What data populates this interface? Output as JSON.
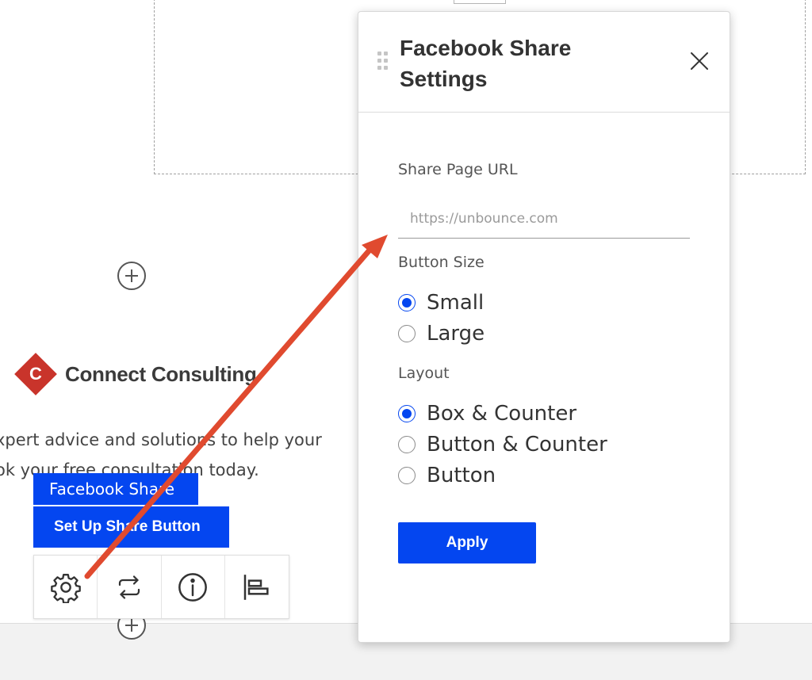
{
  "canvas": {
    "logo_letter": "C",
    "brand_name": "Connect Consulting",
    "body_line_1": "xpert advice and solutions to help your",
    "body_line_2": "ok your free consultation today."
  },
  "widget": {
    "tag_label": "Facebook Share",
    "setup_label": "Set Up Share Button",
    "toolbar": [
      {
        "name": "settings-gear-icon"
      },
      {
        "name": "swap-icon"
      },
      {
        "name": "info-icon"
      },
      {
        "name": "align-icon"
      }
    ]
  },
  "panel": {
    "title": "Facebook Share Settings",
    "url_label": "Share Page URL",
    "url_placeholder": "https://unbounce.com",
    "url_value": "",
    "size_label": "Button Size",
    "size_options": [
      {
        "label": "Small",
        "checked": true
      },
      {
        "label": "Large",
        "checked": false
      }
    ],
    "layout_label": "Layout",
    "layout_options": [
      {
        "label": "Box & Counter",
        "checked": true
      },
      {
        "label": "Button & Counter",
        "checked": false
      },
      {
        "label": "Button",
        "checked": false
      }
    ],
    "apply_label": "Apply"
  },
  "colors": {
    "accent": "#0446f0",
    "annotation_arrow": "#e04a2f",
    "logo_red": "#c9342b"
  }
}
